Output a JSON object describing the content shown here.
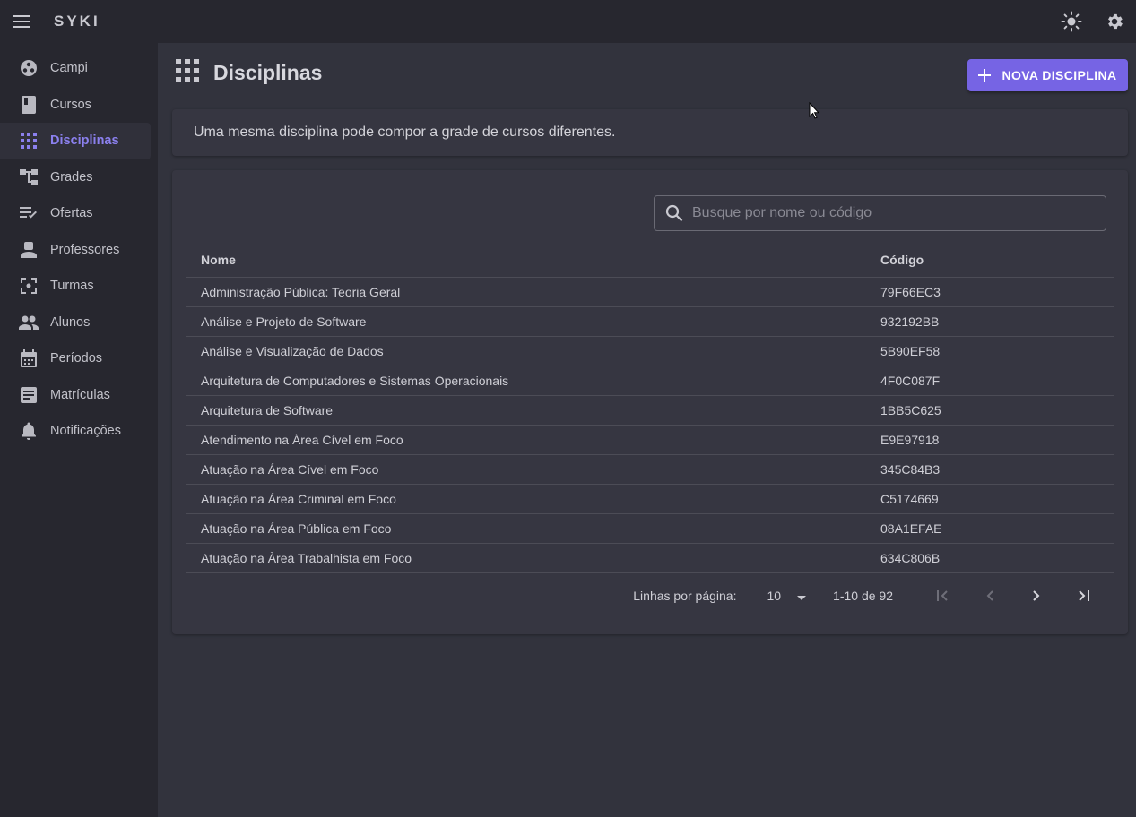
{
  "app": {
    "brand": "SYKI"
  },
  "sidebar": {
    "items": [
      {
        "label": "Campi",
        "icon": "campus-icon",
        "active": false
      },
      {
        "label": "Cursos",
        "icon": "book-icon",
        "active": false
      },
      {
        "label": "Disciplinas",
        "icon": "apps-grid-icon",
        "active": true
      },
      {
        "label": "Grades",
        "icon": "account-tree-icon",
        "active": false
      },
      {
        "label": "Ofertas",
        "icon": "playlist-check-icon",
        "active": false
      },
      {
        "label": "Professores",
        "icon": "person-icon",
        "active": false
      },
      {
        "label": "Turmas",
        "icon": "center-focus-icon",
        "active": false
      },
      {
        "label": "Alunos",
        "icon": "group-icon",
        "active": false
      },
      {
        "label": "Períodos",
        "icon": "calendar-icon",
        "active": false
      },
      {
        "label": "Matrículas",
        "icon": "article-icon",
        "active": false
      },
      {
        "label": "Notificações",
        "icon": "bell-icon",
        "active": false
      }
    ]
  },
  "page": {
    "title": "Disciplinas",
    "new_button": "NOVA DISCIPLINA",
    "info": "Uma mesma disciplina pode compor a grade de cursos diferentes."
  },
  "search": {
    "placeholder": "Busque por nome ou código",
    "value": ""
  },
  "table": {
    "headers": {
      "name": "Nome",
      "code": "Código"
    },
    "rows": [
      {
        "name": "Administração Pública: Teoria Geral",
        "code": "79F66EC3"
      },
      {
        "name": "Análise e Projeto de Software",
        "code": "932192BB"
      },
      {
        "name": "Análise e Visualização de Dados",
        "code": "5B90EF58"
      },
      {
        "name": "Arquitetura de Computadores e Sistemas Operacionais",
        "code": "4F0C087F"
      },
      {
        "name": "Arquitetura de Software",
        "code": "1BB5C625"
      },
      {
        "name": "Atendimento na Área Cível em Foco",
        "code": "E9E97918"
      },
      {
        "name": "Atuação na Área Cível em Foco",
        "code": "345C84B3"
      },
      {
        "name": "Atuação na Área Criminal em Foco",
        "code": "C5174669"
      },
      {
        "name": "Atuação na Área Pública em Foco",
        "code": "08A1EFAE"
      },
      {
        "name": "Atuação na Àrea Trabalhista em Foco",
        "code": "634C806B"
      }
    ]
  },
  "pagination": {
    "rows_label": "Linhas por página:",
    "rows_per_page": "10",
    "range": "1-10 de 92"
  },
  "colors": {
    "accent": "#7664e4",
    "active_nav_text": "#8b80ee",
    "background": "#32333d",
    "surface": "#363641",
    "appbar": "#27272f"
  }
}
